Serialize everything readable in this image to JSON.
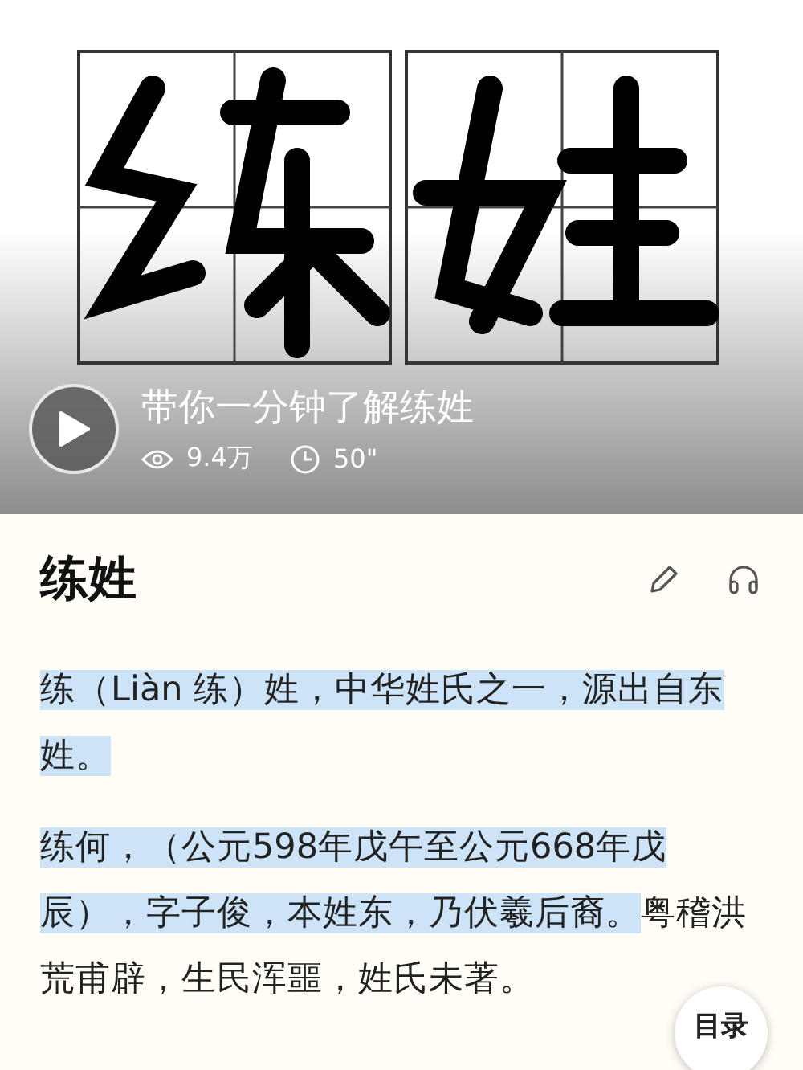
{
  "video": {
    "kind": "picture",
    "title": "带你一分钟了解练姓",
    "views": "9.4万",
    "duration": "50\""
  },
  "article": {
    "title": "练姓",
    "paragraphs": [
      {
        "segments": [
          {
            "text": "练（Liàn 练）姓，中华姓氏之一，源出自东姓。",
            "highlighted": true
          }
        ]
      },
      {
        "segments": [
          {
            "text": "练何，（公元598年戊午至公元668年戊辰），字子俊，本姓东，乃伏羲后裔。",
            "highlighted": true
          },
          {
            "text": "粤稽洪荒甫辟，生民浑噩，姓氏未著。",
            "highlighted": false
          }
        ]
      }
    ]
  },
  "toc_button": {
    "label": "目录"
  }
}
